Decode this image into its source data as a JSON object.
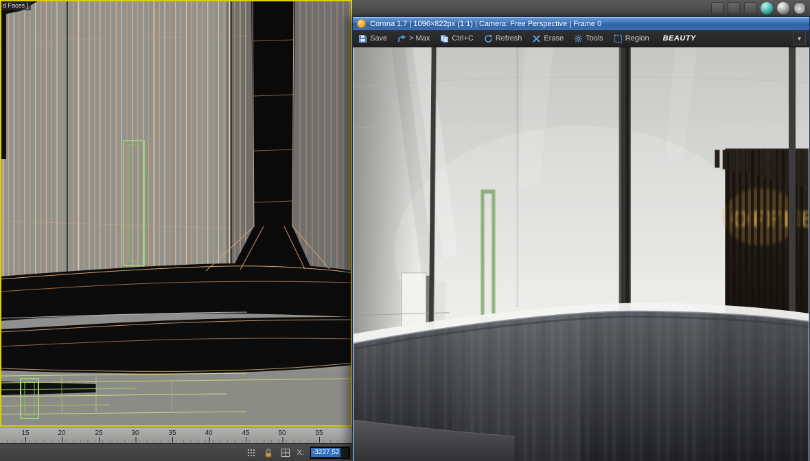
{
  "vfb": {
    "title": "Corona 1.7 | 1096×822px (1:1) | Camera: Free Perspective | Frame 0",
    "toolbar": {
      "buttons": [
        {
          "label": "Save",
          "icon": "save-icon"
        },
        {
          "label": "> Max",
          "icon": "send-to-max-icon"
        },
        {
          "label": "Ctrl+C",
          "icon": "copy-icon"
        },
        {
          "label": "Refresh",
          "icon": "refresh-icon"
        },
        {
          "label": "Erase",
          "icon": "erase-icon"
        },
        {
          "label": "Tools",
          "icon": "tools-icon"
        },
        {
          "label": "Region",
          "icon": "region-icon"
        }
      ],
      "pass_selector": {
        "value": "BEAUTY",
        "arrow_icon": "chevron-down-icon"
      }
    }
  },
  "viewport": {
    "label_fragment": "d Faces ]"
  },
  "trackbar": {
    "ticks": [
      "15",
      "20",
      "25",
      "30",
      "35",
      "40",
      "45",
      "50",
      "55"
    ]
  },
  "statusbar": {
    "icons": [
      "grid-dots-icon",
      "selection-lock-icon",
      "grid-icon"
    ],
    "x_label": "X:",
    "x_value": "-3227,52"
  },
  "topbar": {
    "icons": [
      "toolbar-button-icon",
      "toolbar-button-icon",
      "toolbar-button-icon",
      "material-editor-sphere-icon",
      "render-setup-sphere-icon",
      "render-teapot-icon"
    ]
  },
  "colors": {
    "title_bar_blue": "#3a6db0",
    "toolbar_icon_blue": "#58a0e0",
    "selection_blue": "#2e6fbe",
    "viewport_border_yellow": "#ded000",
    "corona_logo_orange": "#f7a823",
    "wireframe_orange": "#e2aa7e",
    "wireframe_green": "#9ccf72"
  }
}
